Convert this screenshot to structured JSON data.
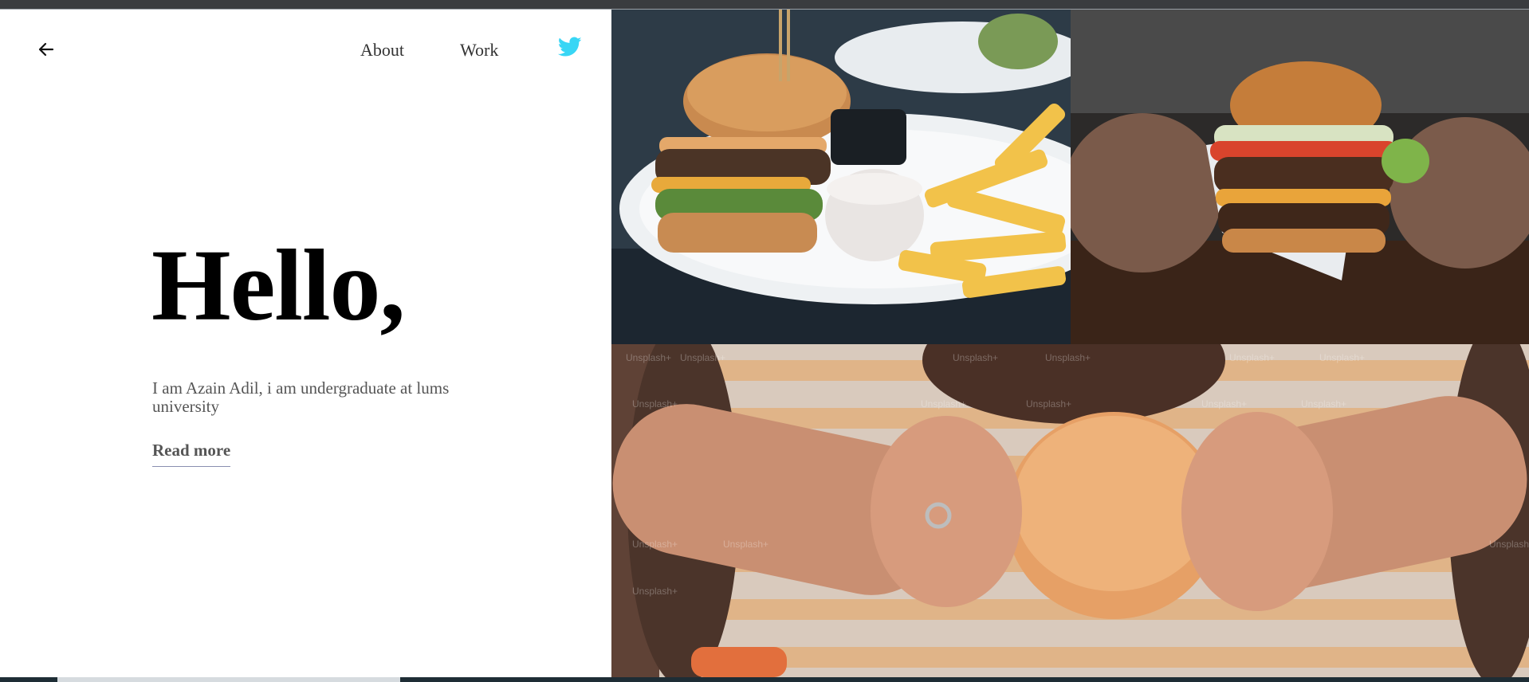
{
  "nav": {
    "back_icon": "arrow-left-icon",
    "about_label": "About",
    "work_label": "Work",
    "twitter_icon": "twitter-icon",
    "twitter_color": "#1da1f2"
  },
  "hero": {
    "heading": "Hello,",
    "bio": "I am Azain Adil, i am undergraduate at lums university",
    "read_more_label": "Read more"
  },
  "gallery": {
    "watermark": "Unsplash+"
  }
}
